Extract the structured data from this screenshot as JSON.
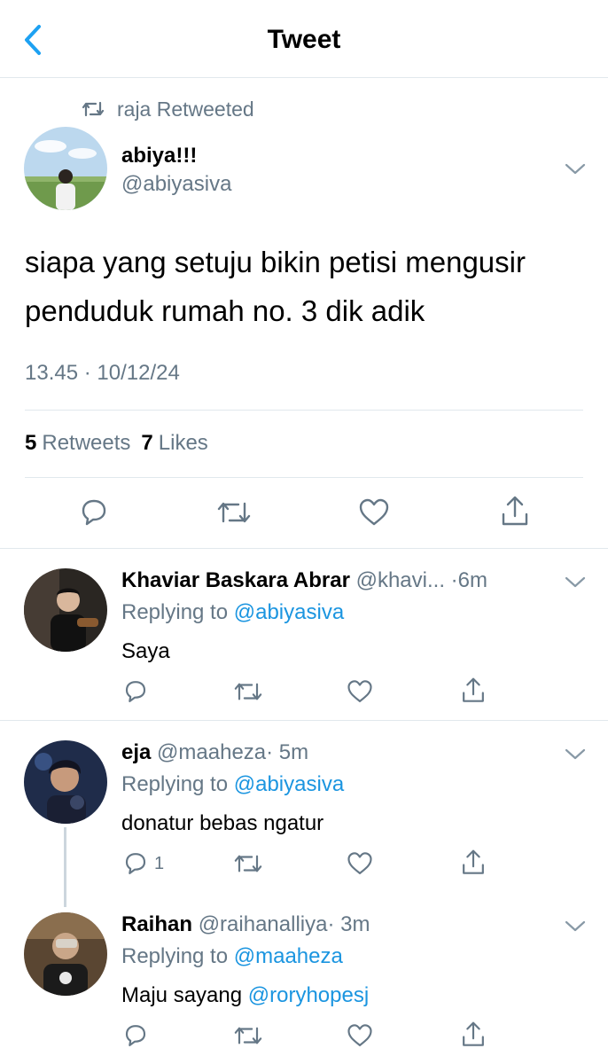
{
  "header": {
    "title": "Tweet",
    "back_icon": "chevron-left-icon",
    "accent": "#1da1f2"
  },
  "retweet_line": {
    "text": "raja Retweeted",
    "icon": "retweet-icon"
  },
  "tweet": {
    "name": "abiya!!!",
    "handle": "@abiyasiva",
    "text": "siapa yang setuju bikin petisi mengusir penduduk rumah no. 3 dik adik",
    "time": "13.45 · 10/12/24",
    "retweets_count": "5",
    "retweets_label": "Retweets",
    "likes_count": "7",
    "likes_label": "Likes"
  },
  "replies": [
    {
      "name": "Khaviar Baskara Abrar",
      "handle": "@khavi...",
      "time": "·6m",
      "replying_label": "Replying to",
      "replying_handle": "@abiyasiva",
      "text": "Saya",
      "reply_count": ""
    },
    {
      "name": "eja",
      "handle": "@maaheza",
      "time": "· 5m",
      "replying_label": "Replying to",
      "replying_handle": "@abiyasiva",
      "text": "donatur bebas ngatur",
      "reply_count": "1"
    },
    {
      "name": "Raihan",
      "handle": "@raihanalliya",
      "time": "· 3m",
      "replying_label": "Replying to",
      "replying_handle": "@maaheza",
      "text_prefix": "Maju sayang",
      "text_mention": "@roryhopesj",
      "reply_count": ""
    }
  ],
  "colors": {
    "link": "#1b95e0",
    "muted": "#657786",
    "divider": "#e1e8ed"
  }
}
